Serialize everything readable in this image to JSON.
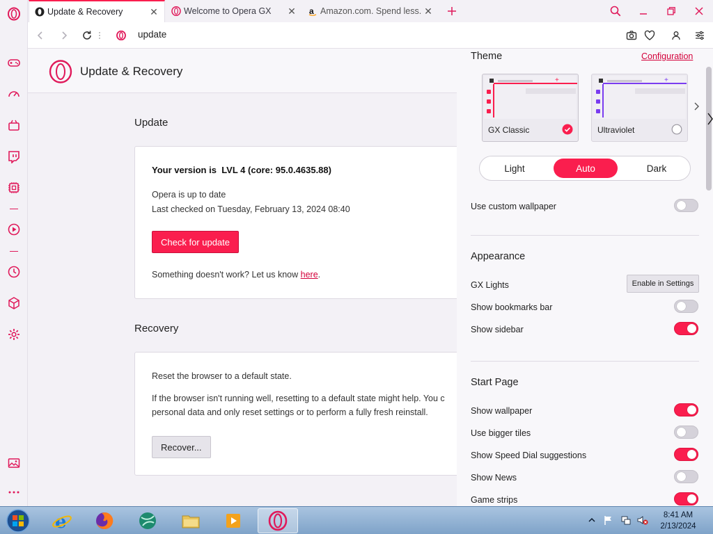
{
  "colors": {
    "accent": "#fa1e4e",
    "opera_red": "#e0195a",
    "taskbar": "#8fb0d6"
  },
  "sidebar": {
    "icons": [
      "opera-logo-icon",
      "gamepad-icon",
      "speed-dial-icon",
      "gx-corner-icon",
      "twitch-icon",
      "cpu-control-icon",
      "player-icon",
      "history-icon",
      "extensions-cube-icon",
      "settings-gear-icon",
      "gallery-icon",
      "more-icon"
    ]
  },
  "tabs": [
    {
      "title": "Update & Recovery",
      "icon": "opera-icon"
    },
    {
      "title": "Welcome to Opera GX",
      "icon": "opera-icon"
    },
    {
      "title": "Amazon.com. Spend less. S",
      "icon": "amazon-icon"
    }
  ],
  "addressbar": {
    "url": "update"
  },
  "page": {
    "title": "Update & Recovery",
    "update": {
      "heading": "Update",
      "version_prefix": "Your version is",
      "version": "LVL 4 (core: 95.0.4635.88)",
      "status": "Opera is up to date",
      "last_checked": "Last checked on Tuesday, February 13, 2024 08:40",
      "check_button": "Check for update",
      "feedback_prefix": "Something doesn't work? Let us know",
      "feedback_link": "here",
      "feedback_suffix": "."
    },
    "recovery": {
      "heading": "Recovery",
      "line1": "Reset the browser to a default state.",
      "line2": "If the browser isn't running well, resetting to a default state might help. You c",
      "line3": "personal data and only reset settings or to perform a fully fresh reinstall.",
      "button": "Recover..."
    }
  },
  "panel": {
    "theme": {
      "heading": "Theme",
      "config_link": "Configuration",
      "cards": [
        {
          "label": "GX Classic",
          "selected": true,
          "color": "#fa1e4e"
        },
        {
          "label": "Ultraviolet",
          "selected": false,
          "color": "#7a3cf0"
        }
      ],
      "modes": [
        "Light",
        "Auto",
        "Dark"
      ],
      "selected_mode": "Auto",
      "custom_wallpaper": {
        "label": "Use custom wallpaper",
        "on": false
      }
    },
    "appearance": {
      "heading": "Appearance",
      "gx_lights": "GX Lights",
      "gx_lights_button": "Enable in Settings",
      "rows": [
        {
          "label": "Show bookmarks bar",
          "on": false
        },
        {
          "label": "Show sidebar",
          "on": true
        }
      ]
    },
    "start_page": {
      "heading": "Start Page",
      "rows": [
        {
          "label": "Show wallpaper",
          "on": true
        },
        {
          "label": "Use bigger tiles",
          "on": false
        },
        {
          "label": "Show Speed Dial suggestions",
          "on": true
        },
        {
          "label": "Show News",
          "on": false
        },
        {
          "label": "Game strips",
          "on": true
        }
      ]
    }
  },
  "taskbar": {
    "apps": [
      "start-orb-icon",
      "internet-explorer-icon",
      "firefox-icon",
      "app-globe-icon",
      "file-explorer-icon",
      "media-player-icon",
      "opera-gx-icon"
    ],
    "time": "8:41 AM",
    "date": "2/13/2024"
  }
}
